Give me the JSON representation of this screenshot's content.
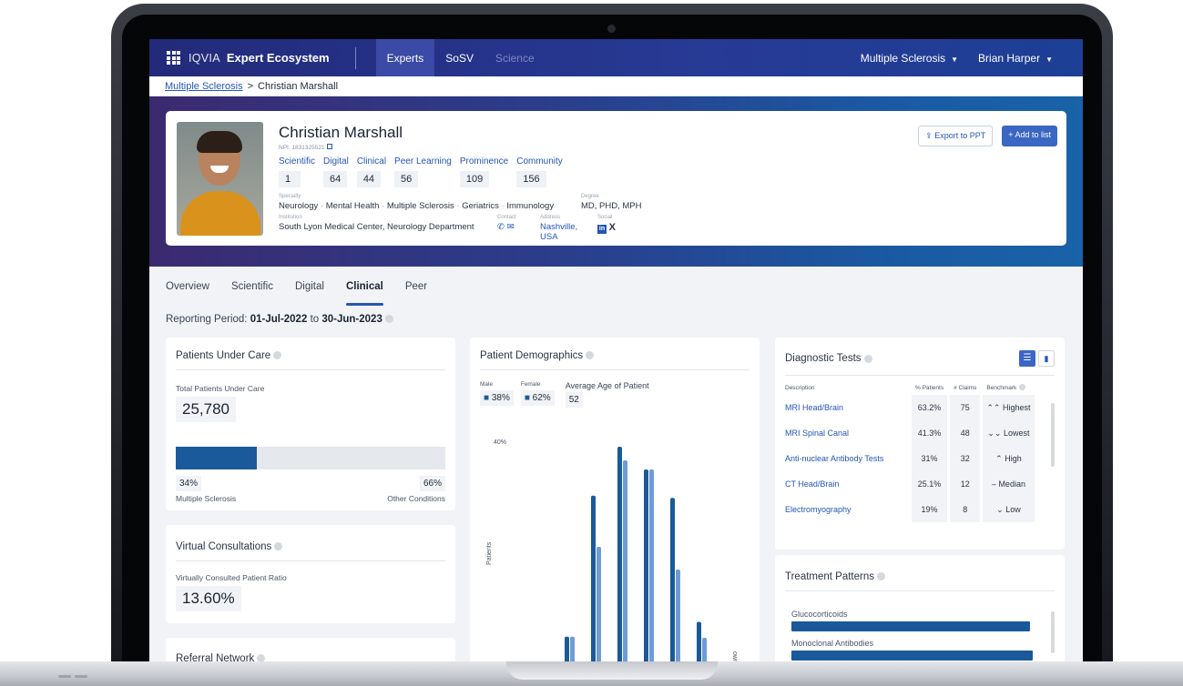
{
  "nav": {
    "brand": "IQVIA",
    "app_name": "Expert Ecosystem",
    "tabs": [
      "Experts",
      "SoSV",
      "Science"
    ],
    "active_tab": "Experts",
    "therapy_area": "Multiple Sclerosis",
    "user_name": "Brian Harper"
  },
  "breadcrumb": {
    "parent": "Multiple Sclerosis",
    "separator": ">",
    "current": "Christian Marshall"
  },
  "profile": {
    "name": "Christian Marshall",
    "npi": "NPI: 1831325521",
    "scores": [
      {
        "label": "Scientific",
        "value": "1"
      },
      {
        "label": "Digital",
        "value": "64"
      },
      {
        "label": "Clinical",
        "value": "44"
      },
      {
        "label": "Peer Learning",
        "value": "56"
      },
      {
        "label": "Prominence",
        "value": "109"
      },
      {
        "label": "Community",
        "value": "156"
      }
    ],
    "specialty_label": "Specialty",
    "specialties": [
      "Neurology",
      "Mental Health",
      "Multiple Sclerosis",
      "Geriatrics",
      "Immunology"
    ],
    "degree_label": "Degree",
    "degree": "MD, PHD, MPH",
    "institution_label": "Institution",
    "institution": "South Lyon Medical Center, Neurology Department",
    "contact_label": "Contact",
    "address_label": "Address",
    "address": "Nashville, USA",
    "social_label": "Social",
    "export_label": "Export to PPT",
    "add_label": "+ Add to list"
  },
  "tabs": [
    "Overview",
    "Scientific",
    "Digital",
    "Clinical",
    "Peer"
  ],
  "active_tab": "Clinical",
  "reporting": {
    "label": "Reporting Period:",
    "start": "01-Jul-2022",
    "to": "to",
    "end": "30-Jun-2023"
  },
  "patients_under_care": {
    "title": "Patients Under Care",
    "total_label": "Total Patients Under Care",
    "total": "25,780",
    "ms_pct": "34%",
    "other_pct": "66%",
    "ms_fraction": 0.3,
    "ms_label": "Multiple Sclerosis",
    "other_label": "Other Conditions"
  },
  "virtual_consultations": {
    "title": "Virtual Consultations",
    "ratio_label": "Virtually Consulted Patient Ratio",
    "ratio": "13.60%"
  },
  "referral_network": {
    "title": "Referral Network"
  },
  "demographics": {
    "title": "Patient Demographics",
    "male_label": "Male",
    "male_pct": "38%",
    "female_label": "Female",
    "female_pct": "62%",
    "avg_age_label": "Average Age of Patient",
    "avg_age": "52",
    "y_axis_label": "Patients",
    "y_tick": "40%",
    "x_tick_fragment": "own",
    "colors": {
      "male": "#1a5a9a",
      "female": "#6f9bd6"
    }
  },
  "chart_data": {
    "type": "bar",
    "ylabel": "Patients",
    "series": [
      {
        "name": "Male",
        "values": [
          0,
          0,
          0.125,
          0.745,
          0.96,
          0.86,
          0.735,
          0.19,
          0.015
        ]
      },
      {
        "name": "Female",
        "values": [
          0,
          0,
          0.125,
          0.52,
          0.9,
          0.86,
          0.42,
          0.12,
          0
        ]
      }
    ]
  },
  "diagnostic_tests": {
    "title": "Diagnostic Tests",
    "headers": [
      "Description",
      "% Patients",
      "# Claims",
      "Benchmark"
    ],
    "rows": [
      {
        "desc": "MRI Head/Brain",
        "pct": "63.2%",
        "claims": "75",
        "bench_icon": "double-up",
        "bench": "Highest"
      },
      {
        "desc": "MRI Spinal Canal",
        "pct": "41.3%",
        "claims": "48",
        "bench_icon": "double-down",
        "bench": "Lowest"
      },
      {
        "desc": "Anti-nuclear Antibody Tests",
        "pct": "31%",
        "claims": "32",
        "bench_icon": "up",
        "bench": "High"
      },
      {
        "desc": "CT Head/Brain",
        "pct": "25.1%",
        "claims": "12",
        "bench_icon": "dash",
        "bench": "Median"
      },
      {
        "desc": "Electromyography",
        "pct": "19%",
        "claims": "8",
        "bench_icon": "down",
        "bench": "Low"
      }
    ]
  },
  "treatment_patterns": {
    "title": "Treatment Patterns",
    "items": [
      {
        "label": "Glucocorticoids",
        "fraction": 0.97
      },
      {
        "label": "Monoclonal Antibodies",
        "fraction": 0.98
      }
    ]
  },
  "colors": {
    "nav": "#273a95",
    "accent": "#2456b4",
    "bar": "#1a5a9a"
  }
}
